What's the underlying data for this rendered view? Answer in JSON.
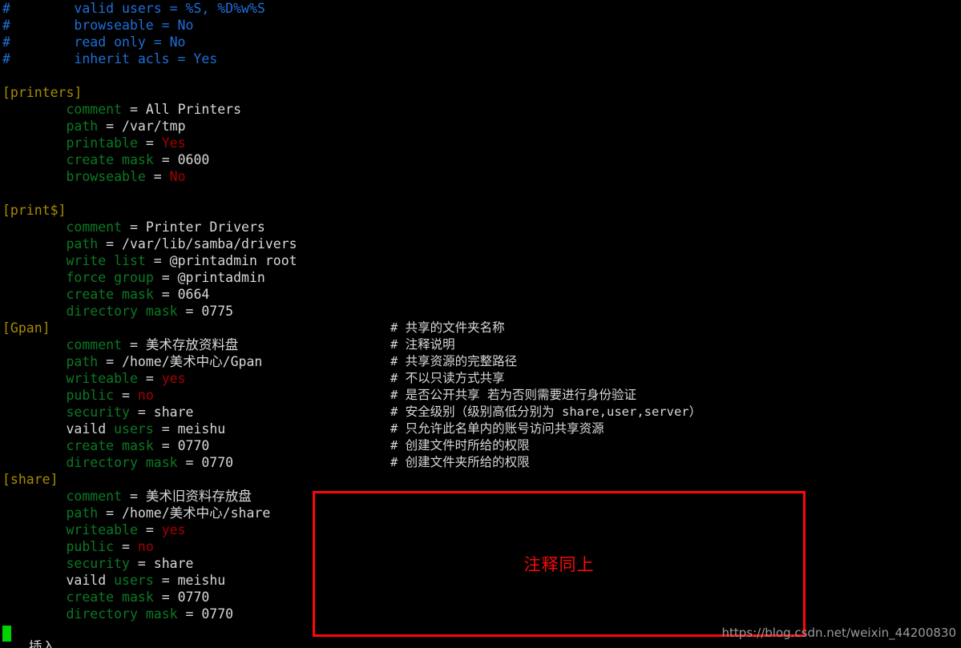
{
  "terminal": {
    "background_color": "#000000",
    "colors": {
      "comment_blue": "#1e6fd9",
      "section_yellow": "#a88a00",
      "key_green": "#0a7a22",
      "value_white": "#d8d8d8",
      "bool_red": "#a50000",
      "cursor_green": "#00d400",
      "annotation_red": "#fb0808"
    },
    "lines": [
      {
        "type": "comment",
        "text": "#        valid users = %S, %D%w%S"
      },
      {
        "type": "comment",
        "text": "#        browseable = No"
      },
      {
        "type": "comment",
        "text": "#        read only = No"
      },
      {
        "type": "comment",
        "text": "#        inherit acls = Yes"
      },
      {
        "type": "blank",
        "text": ""
      },
      {
        "type": "section",
        "text": "[printers]"
      },
      {
        "type": "kv",
        "indent": "        ",
        "key": "comment",
        "value": "All Printers",
        "value_kind": "plain"
      },
      {
        "type": "kv",
        "indent": "        ",
        "key": "path",
        "value": "/var/tmp",
        "value_kind": "plain"
      },
      {
        "type": "kv",
        "indent": "        ",
        "key": "printable",
        "value": "Yes",
        "value_kind": "bool"
      },
      {
        "type": "kv",
        "indent": "        ",
        "key": "create mask",
        "value": "0600",
        "value_kind": "plain"
      },
      {
        "type": "kv",
        "indent": "        ",
        "key": "browseable",
        "value": "No",
        "value_kind": "bool"
      },
      {
        "type": "blank",
        "text": ""
      },
      {
        "type": "section",
        "text": "[print$]"
      },
      {
        "type": "kv",
        "indent": "        ",
        "key": "comment",
        "value": "Printer Drivers",
        "value_kind": "plain"
      },
      {
        "type": "kv",
        "indent": "        ",
        "key": "path",
        "value": "/var/lib/samba/drivers",
        "value_kind": "plain"
      },
      {
        "type": "kv",
        "indent": "        ",
        "key": "write list",
        "value": "@printadmin root",
        "value_kind": "plain"
      },
      {
        "type": "kv",
        "indent": "        ",
        "key": "force group",
        "value": "@printadmin",
        "value_kind": "plain"
      },
      {
        "type": "kv",
        "indent": "        ",
        "key": "create mask",
        "value": "0664",
        "value_kind": "plain"
      },
      {
        "type": "kv",
        "indent": "        ",
        "key": "directory mask",
        "value": "0775",
        "value_kind": "plain"
      },
      {
        "type": "section",
        "text": "[Gpan]",
        "note": "# 共享的文件夹名称"
      },
      {
        "type": "kv",
        "indent": "        ",
        "key": "comment",
        "value": "美术存放资料盘",
        "value_kind": "plain",
        "note": "# 注释说明"
      },
      {
        "type": "kv",
        "indent": "        ",
        "key": "path",
        "value": "/home/美术中心/Gpan",
        "value_kind": "plain",
        "note": "# 共享资源的完整路径"
      },
      {
        "type": "kv",
        "indent": "        ",
        "key": "writeable",
        "value": "yes",
        "value_kind": "bool",
        "note": "# 不以只读方式共享"
      },
      {
        "type": "kv",
        "indent": "        ",
        "key": "public",
        "value": "no",
        "value_kind": "bool",
        "note": "# 是否公开共享 若为否则需要进行身份验证"
      },
      {
        "type": "kv",
        "indent": "        ",
        "key": "security",
        "value": "share",
        "value_kind": "plain",
        "note": "# 安全级别（级别高低分别为 share,user,server）"
      },
      {
        "type": "kv_typo",
        "indent": "        ",
        "key_bad": "vaild",
        "key": "users",
        "value": "meishu",
        "value_kind": "plain",
        "note": "# 只允许此名单内的账号访问共享资源"
      },
      {
        "type": "kv",
        "indent": "        ",
        "key": "create mask",
        "value": "0770",
        "value_kind": "plain",
        "note": "# 创建文件时所给的权限"
      },
      {
        "type": "kv",
        "indent": "        ",
        "key": "directory mask",
        "value": "0770",
        "value_kind": "plain",
        "note": "# 创建文件夹所给的权限"
      },
      {
        "type": "section",
        "text": "[share]"
      },
      {
        "type": "kv",
        "indent": "        ",
        "key": "comment",
        "value": "美术旧资料存放盘",
        "value_kind": "plain"
      },
      {
        "type": "kv",
        "indent": "        ",
        "key": "path",
        "value": "/home/美术中心/share",
        "value_kind": "plain"
      },
      {
        "type": "kv",
        "indent": "        ",
        "key": "writeable",
        "value": "yes",
        "value_kind": "bool"
      },
      {
        "type": "kv",
        "indent": "        ",
        "key": "public",
        "value": "no",
        "value_kind": "bool"
      },
      {
        "type": "kv",
        "indent": "        ",
        "key": "security",
        "value": "share",
        "value_kind": "plain"
      },
      {
        "type": "kv_typo",
        "indent": "        ",
        "key_bad": "vaild",
        "key": "users",
        "value": "meishu",
        "value_kind": "plain"
      },
      {
        "type": "kv",
        "indent": "        ",
        "key": "create mask",
        "value": "0770",
        "value_kind": "plain"
      },
      {
        "type": "kv",
        "indent": "        ",
        "key": "directory mask",
        "value": "0770",
        "value_kind": "plain"
      }
    ],
    "clipped_bottom_line": "插入",
    "cursor_present": true
  },
  "annotation": {
    "red_box_label": "注释同上"
  },
  "watermark": {
    "text": "https://blog.csdn.net/weixin_44200830"
  }
}
